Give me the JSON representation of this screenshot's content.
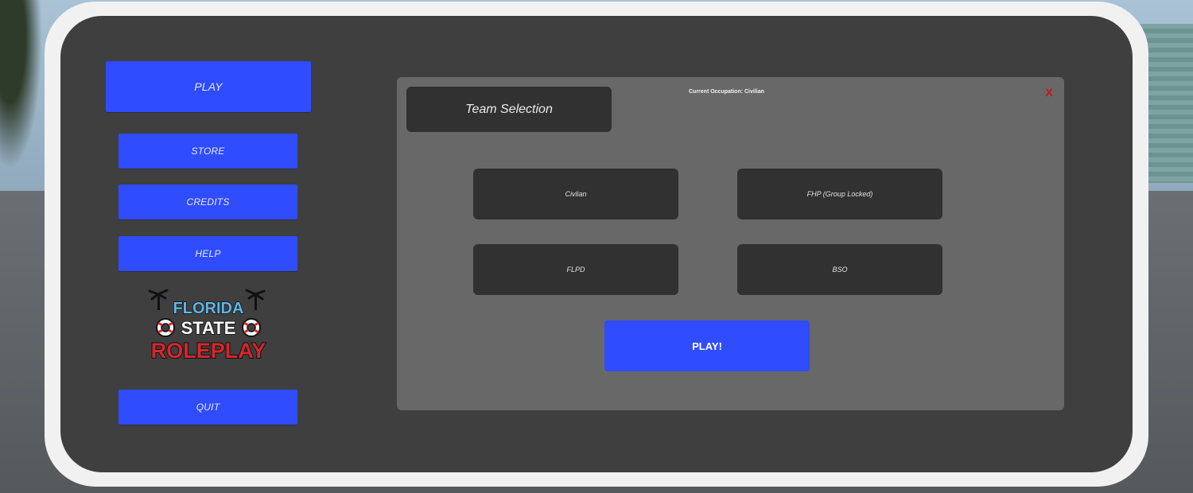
{
  "sidebar": {
    "play_label": "PLAY",
    "store_label": "STORE",
    "credits_label": "CREDITS",
    "help_label": "HELP",
    "quit_label": "QUIT"
  },
  "logo": {
    "line1": "FLORIDA",
    "line2": "STATE",
    "line3": "ROLEPLAY"
  },
  "team_selection": {
    "title": "Team Selection",
    "current_occupation": "Current Occupation: Civilian",
    "close_label": "X",
    "teams": [
      {
        "label": "Civlian"
      },
      {
        "label": "FHP (Group Locked)"
      },
      {
        "label": "FLPD"
      },
      {
        "label": "BSO"
      }
    ],
    "play_label": "PLAY!"
  },
  "colors": {
    "accent": "#2f4cff",
    "panel": "#3f3f3f",
    "inner_panel": "#686868",
    "button_dark": "#313131",
    "close": "#c4161c"
  }
}
